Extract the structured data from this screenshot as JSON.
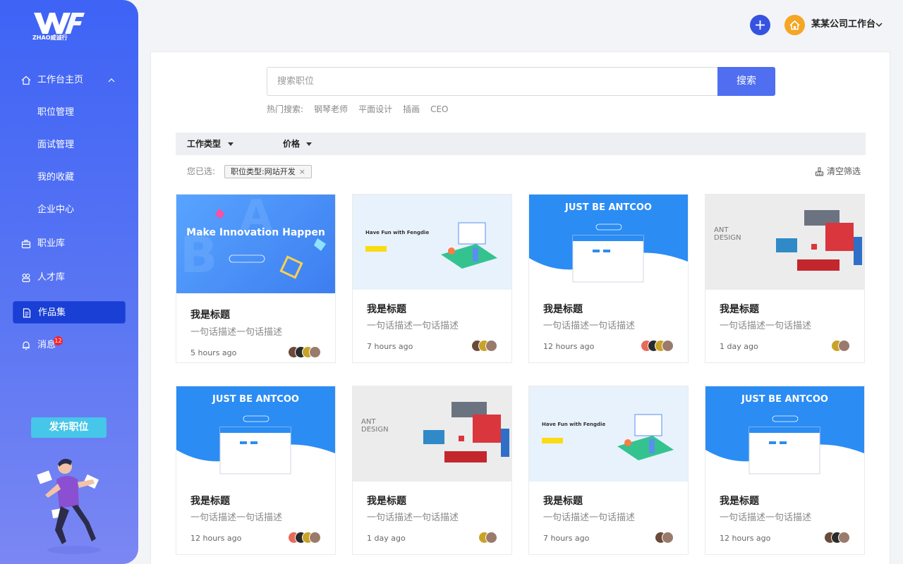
{
  "brand": {
    "logo_text": "ZHAO威诚行"
  },
  "sidebar": {
    "items": [
      {
        "label": "工作台主页",
        "icon": "home-icon"
      },
      {
        "label": "职位管理"
      },
      {
        "label": "面试管理"
      },
      {
        "label": "我的收藏"
      },
      {
        "label": "企业中心"
      },
      {
        "label": "职业库",
        "icon": "briefcase-icon"
      },
      {
        "label": "人才库",
        "icon": "people-icon"
      },
      {
        "label": "作品集",
        "icon": "document-icon",
        "active": true
      },
      {
        "label": "消息",
        "icon": "bell-icon",
        "badge": "12"
      }
    ],
    "publish_label": "发布职位"
  },
  "topbar": {
    "workspace_name": "某某公司工作台"
  },
  "search": {
    "placeholder": "搜索职位",
    "button_label": "搜索",
    "hot_label": "热门搜索:",
    "hot_keywords": [
      "钢琴老师",
      "平面设计",
      "插画",
      "CEO"
    ]
  },
  "filters": {
    "job_type": "工作类型",
    "price": "价格",
    "selected_label": "您已选:",
    "selected_tag": "职位类型:网站开发",
    "tag_close": "×",
    "clear_label": "清空筛选"
  },
  "cards": [
    {
      "banner": "Make Innovation Happen",
      "title": "我是标题",
      "desc": "一句话描述一句话描述",
      "time": "5 hours ago"
    },
    {
      "banner": "Have Fun with Fengdie",
      "title": "我是标题",
      "desc": "一句话描述一句话描述",
      "time": "7 hours ago"
    },
    {
      "banner": "JUST BE ANTCOO",
      "title": "我是标题",
      "desc": "一句话描述一句话描述",
      "time": "12 hours ago"
    },
    {
      "banner": "ANT DESIGN",
      "title": "我是标题",
      "desc": "一句话描述一句话描述",
      "time": "1 day ago"
    },
    {
      "banner": "JUST BE ANTCOO",
      "title": "我是标题",
      "desc": "一句话描述一句话描述",
      "time": "12 hours ago"
    },
    {
      "banner": "ANT DESIGN",
      "title": "我是标题",
      "desc": "一句话描述一句话描述",
      "time": "1 day ago"
    },
    {
      "banner": "Have Fun with Fengdie",
      "title": "我是标题",
      "desc": "一句话描述一句话描述",
      "time": "7 hours ago"
    },
    {
      "banner": "JUST BE ANTCOO",
      "title": "我是标题",
      "desc": "一句话描述一句话描述",
      "time": "12 hours ago"
    }
  ],
  "colors": {
    "primary": "#4f6ef0",
    "sidebar_top": "#3e63f5",
    "sidebar_bottom": "#7b87f3",
    "accent": "#46c6e8",
    "badge": "#f5222d"
  }
}
